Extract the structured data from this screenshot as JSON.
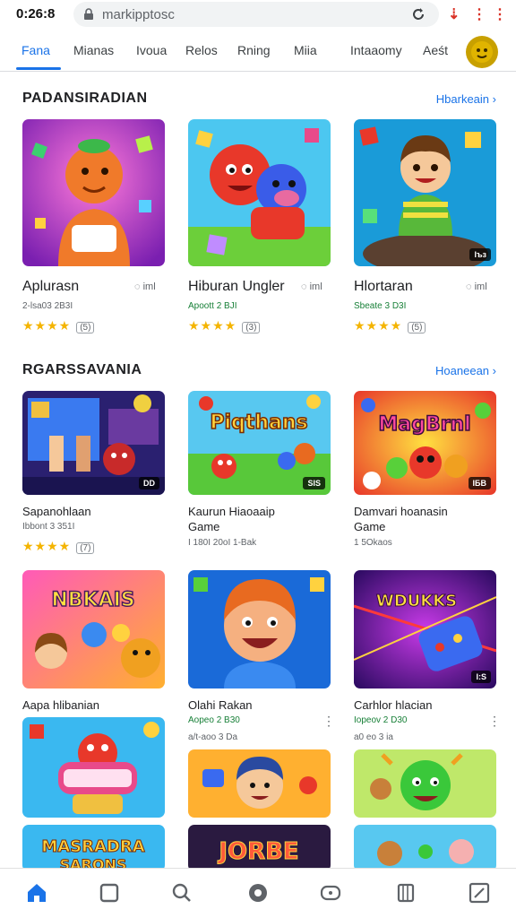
{
  "status": {
    "time": "0:26:8"
  },
  "browser": {
    "url": "markipptosc",
    "icons": [
      "lock-icon",
      "reload-icon",
      "download-icon",
      "more-icon"
    ]
  },
  "tabs": [
    {
      "label": "Fana",
      "active": true
    },
    {
      "label": "Mianas"
    },
    {
      "label": "Ivoua"
    },
    {
      "label": "Relos"
    },
    {
      "label": "Rning"
    },
    {
      "label": "Miia"
    },
    {
      "label": "Intaaomy"
    },
    {
      "label": "Aeśt"
    }
  ],
  "section1": {
    "title": "PADANSIRADIAN",
    "more": "Hbarkeain",
    "items": [
      {
        "name": "Aplurasn",
        "extra": "iml",
        "sub": "2-lsa03 2B3I",
        "stars": "★★★★",
        "count": "(5)"
      },
      {
        "name": "Hiburan Ungler",
        "extra": "iml",
        "sub": "Apoott 2 BJI",
        "stars": "★★★★",
        "count": "(3)"
      },
      {
        "name": "Hlortaran",
        "extra": "iml",
        "sub": "Sbeate 3 D3I",
        "stars": "★★★★",
        "count": "(5)",
        "badge": "Iъз"
      }
    ]
  },
  "section2": {
    "title": "RGARSSAVANIA",
    "more": "Hoaneean",
    "items": [
      {
        "name": "Sapanohlaan",
        "sub": "Ibbont 3 351I",
        "stars": "★★★★",
        "count": "(7)",
        "badge": "DD"
      },
      {
        "name": "Kaurun Hiaoaaip",
        "name2": "Game",
        "sub": "I 180I 20oI 1-Bak",
        "badge": "SIS",
        "art": "Piqthans"
      },
      {
        "name": "Damvari hoanasin",
        "name2": "Game",
        "sub": "1 5Okaos",
        "badge": "IБB",
        "art": "MagBrnl"
      }
    ]
  },
  "section3": {
    "items": [
      {
        "name": "Aapa hlibanian",
        "art": "NBKAIS"
      },
      {
        "name": "Olahi Rakan",
        "sub": "Aopeo 2 B30",
        "sub2": "a/t-aoo 3 Da",
        "sub_green": true
      },
      {
        "name": "Carhlor hlacian",
        "sub": "Iopeov 2 D30",
        "sub2": "a0 eo 3 ia",
        "sub_green": true,
        "art": "WDUKKS",
        "badge": "I:S"
      }
    ]
  },
  "section4": {
    "art": [
      "MASRADRA",
      "SARONS",
      "JORBE"
    ]
  },
  "bottom_nav": [
    "home-icon",
    "apps-icon",
    "search-icon",
    "circle-icon",
    "games-icon",
    "library-icon",
    "edit-icon"
  ],
  "colors": {
    "accent": "#1a73e8",
    "star": "#f4b400",
    "green": "#188038"
  }
}
